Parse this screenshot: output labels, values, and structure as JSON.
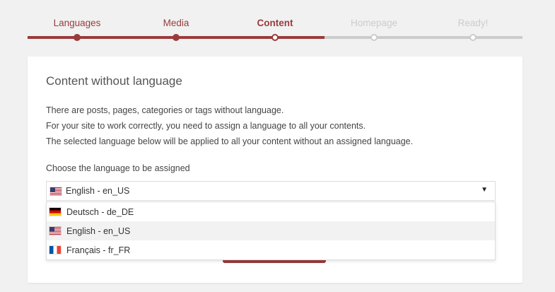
{
  "steps": [
    {
      "label": "Languages",
      "state": "done"
    },
    {
      "label": "Media",
      "state": "done"
    },
    {
      "label": "Content",
      "state": "current"
    },
    {
      "label": "Homepage",
      "state": "todo"
    },
    {
      "label": "Ready!",
      "state": "todo"
    }
  ],
  "content": {
    "title": "Content without language",
    "paragraphs": [
      "There are posts, pages, categories or tags without language.",
      "For your site to work correctly, you need to assign a language to all your contents.",
      "The selected language below will be applied to all your content without an assigned language."
    ],
    "field_label": "Choose the language to be assigned",
    "selected": {
      "label": "English - en_US",
      "flag": "us-flag-icon"
    },
    "caret": "▼",
    "options": [
      {
        "label": "Deutsch - de_DE",
        "flag": "de-flag-icon"
      },
      {
        "label": "English - en_US",
        "flag": "us-flag-icon"
      },
      {
        "label": "Français - fr_FR",
        "flag": "fr-flag-icon"
      }
    ]
  },
  "colors": {
    "accent": "#9a3b3b",
    "inactive": "#cccccc",
    "background": "#f1f1f1"
  }
}
